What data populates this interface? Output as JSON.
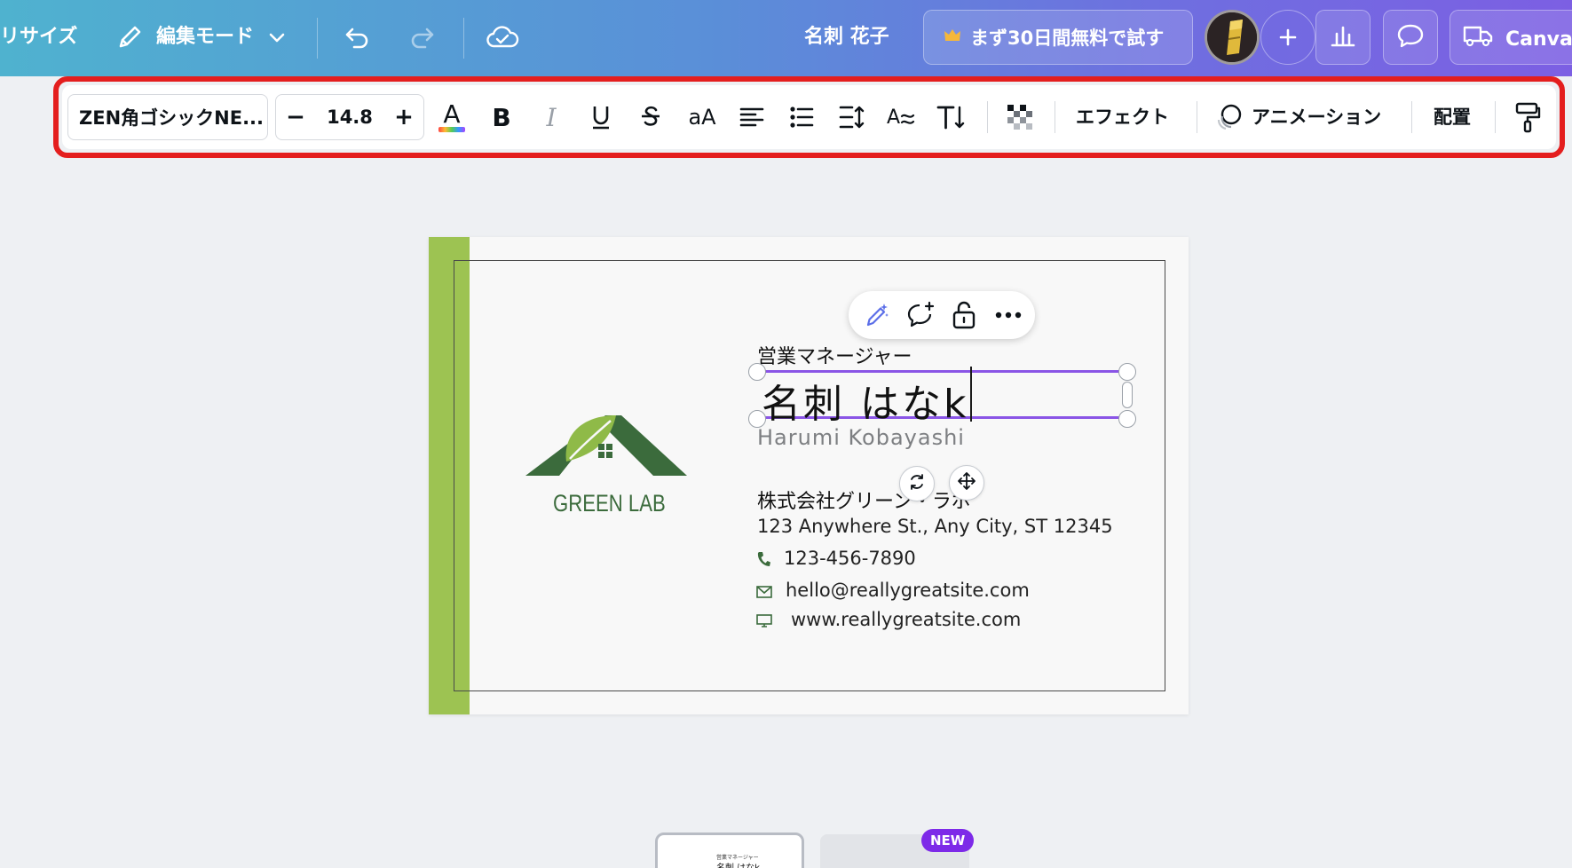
{
  "header": {
    "resize_label": "リサイズ",
    "edit_mode_label": "編集モード",
    "doc_title": "名刺 花子",
    "trial_label": "まず30日間無料で試す",
    "share_label": "Canvaで"
  },
  "toolbar": {
    "font_name": "ZEN角ゴシックNE...",
    "size_minus": "−",
    "font_size": "14.8",
    "size_plus": "+",
    "effects_label": "エフェクト",
    "animation_label": "アニメーション",
    "position_label": "配置",
    "case_label": "aA"
  },
  "card": {
    "logo_text": "GREEN LAB",
    "job_title": "営業マネージャー",
    "name_editing": "名刺 はなk",
    "name_romaji": "Harumi Kobayashi",
    "company": "株式会社グリーン・ラボ",
    "address": "123 Anywhere St., Any City, ST 12345",
    "phone": "123-456-7890",
    "email": "hello@reallygreatsite.com",
    "website": "www.reallygreatsite.com"
  },
  "pages": {
    "thumb_title": "営業マネージャー",
    "thumb_name": "名刺 はなk",
    "new_badge": "NEW"
  },
  "colors": {
    "accent_green": "#9dc352",
    "logo_green": "#3b6b3c",
    "selection_purple": "#8a55e6",
    "highlight_red": "#e41e1e"
  }
}
